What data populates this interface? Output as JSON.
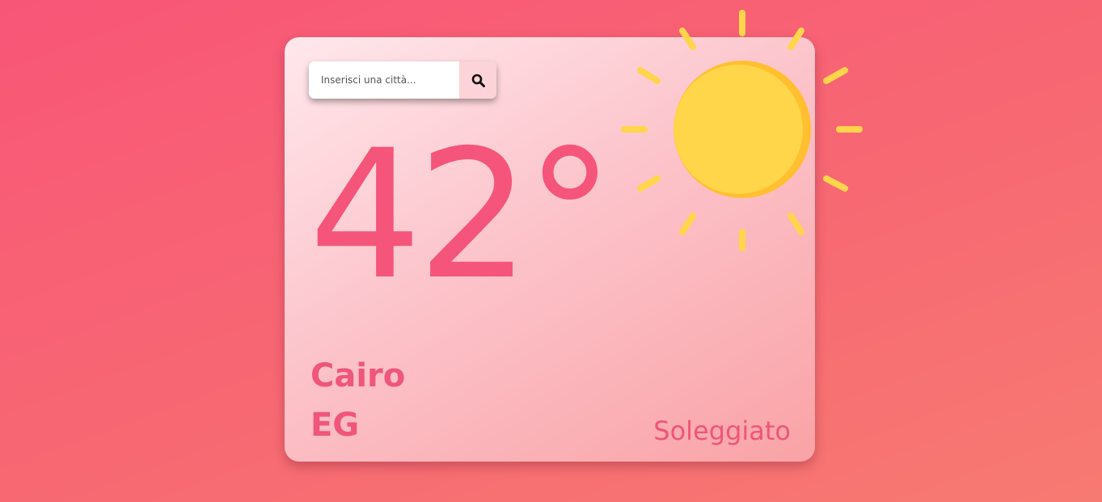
{
  "search": {
    "placeholder": "Inserisci una città...",
    "value": "",
    "button_icon": "search-icon"
  },
  "weather": {
    "temperature": "42°",
    "city": "Cairo",
    "country": "EG",
    "condition": "Soleggiato",
    "icon": "sun-icon"
  },
  "colors": {
    "accent": "#f0557a",
    "sun": "#ffd54a",
    "sun_shade": "#ffbf2e",
    "background_top": "#f85677",
    "background_bottom": "#f77a72"
  }
}
